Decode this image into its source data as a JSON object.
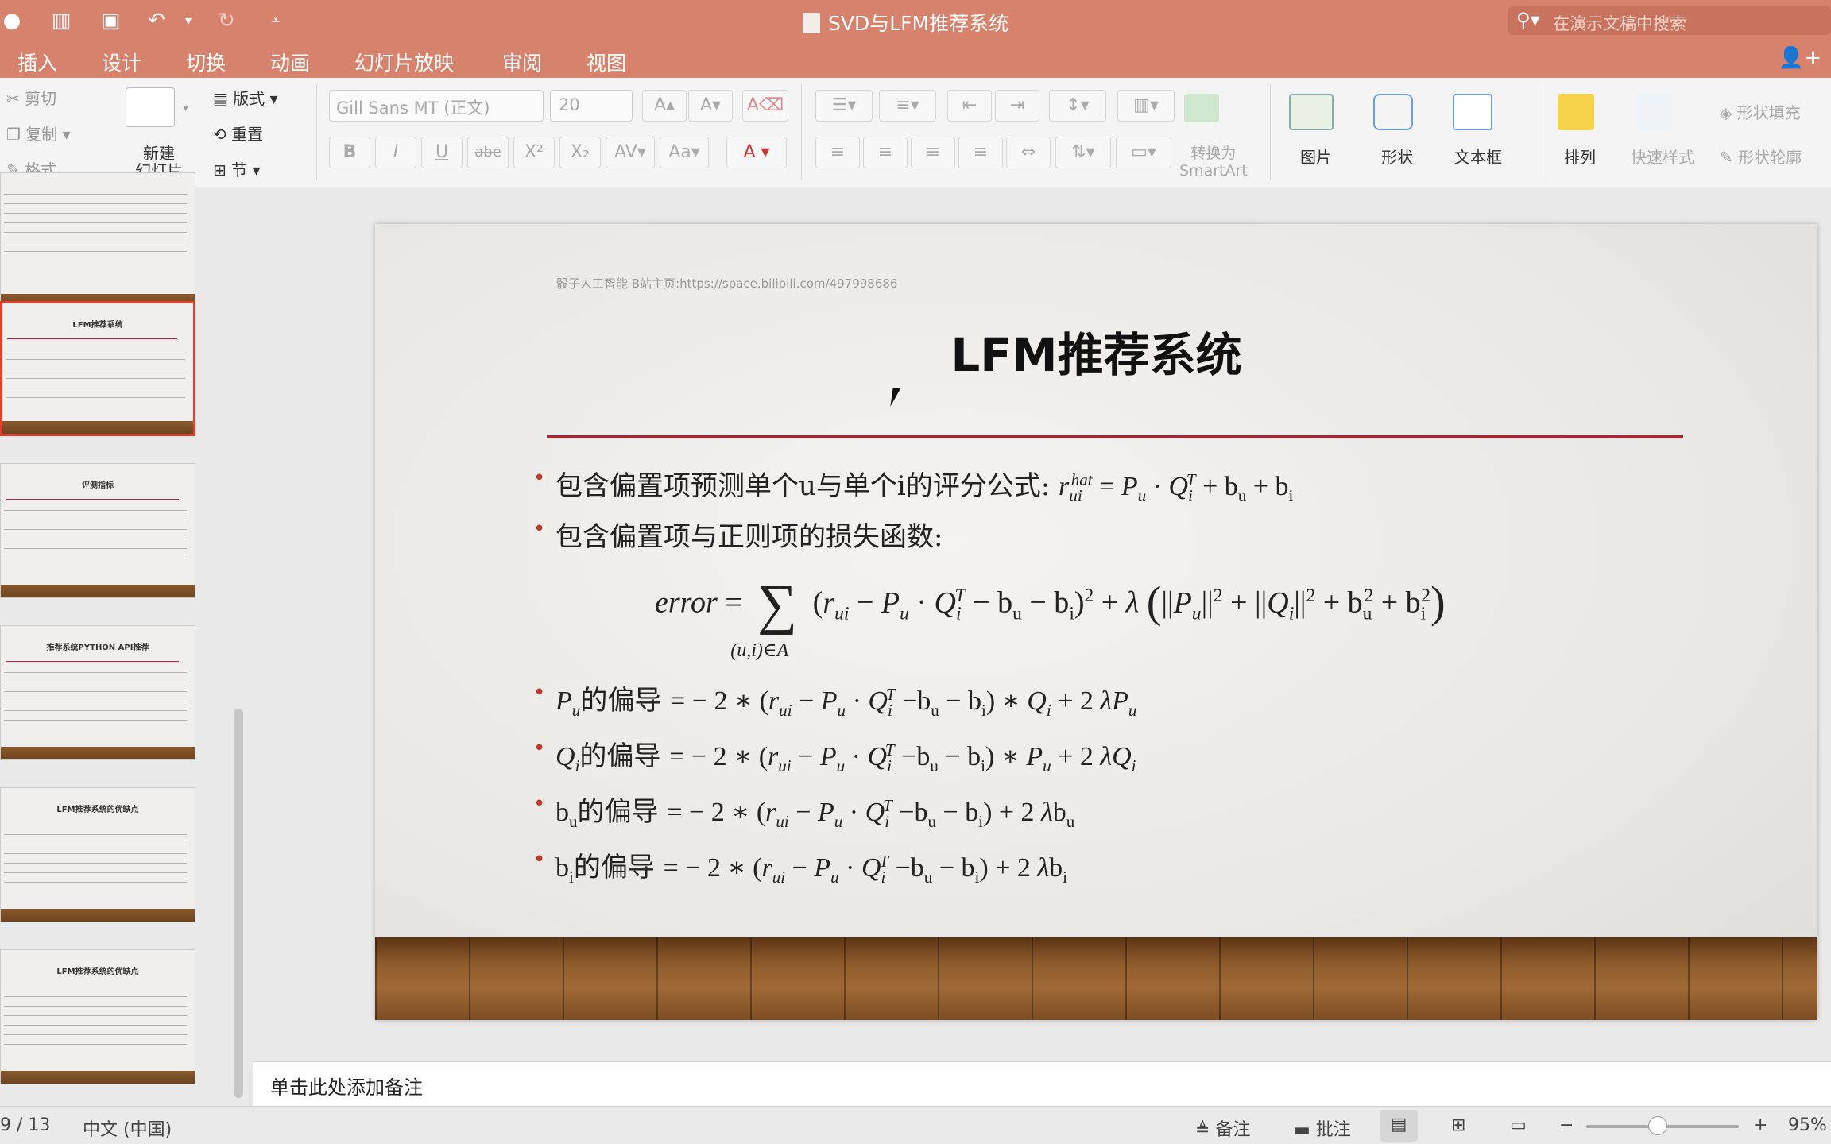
{
  "titlebar": {
    "title": "SVD与LFM推荐系统",
    "search_placeholder": "在演示文稿中搜索"
  },
  "tabs": [
    "插入",
    "设计",
    "切换",
    "动画",
    "幻灯片放映",
    "审阅",
    "视图"
  ],
  "ribbon": {
    "cut": "剪切",
    "copy": "复制",
    "format": "格式",
    "new_slide": "新建\n幻灯片",
    "layout": "版式",
    "reset": "重置",
    "section": "节",
    "font_name": "Gill Sans MT (正文)",
    "font_size": "20",
    "convert_smartart": "转换为\nSmartArt",
    "picture": "图片",
    "shape": "形状",
    "textbox": "文本框",
    "arrange": "排列",
    "quick_styles": "快速样式",
    "shape_fill": "形状填充",
    "shape_outline": "形状轮廓"
  },
  "thumbnails": [
    {
      "title": ""
    },
    {
      "title": "LFM推荐系统",
      "selected": true
    },
    {
      "title": "评测指标"
    },
    {
      "title": "推荐系统PYTHON API推荐"
    },
    {
      "title": "LFM推荐系统的优缺点"
    },
    {
      "title": "LFM推荐系统的优缺点"
    }
  ],
  "slide": {
    "watermark": "骰子人工智能 B站主页:https://space.bilibili.com/497998686",
    "title": "LFM推荐系统",
    "bullet1_text": "包含偏置项预测单个u与单个i的评分公式: ",
    "bullet2_text": "包含偏置项与正则项的损失函数:",
    "bullet3_text": "的偏导",
    "bullet4_text": "的偏导",
    "bullet5_text": "的偏导",
    "bullet6_text": "的偏导"
  },
  "notes_placeholder": "单击此处添加备注",
  "status": {
    "page": "9 / 13",
    "language": "中文 (中国)",
    "notes": "备注",
    "comments": "批注",
    "zoom": "95%"
  }
}
